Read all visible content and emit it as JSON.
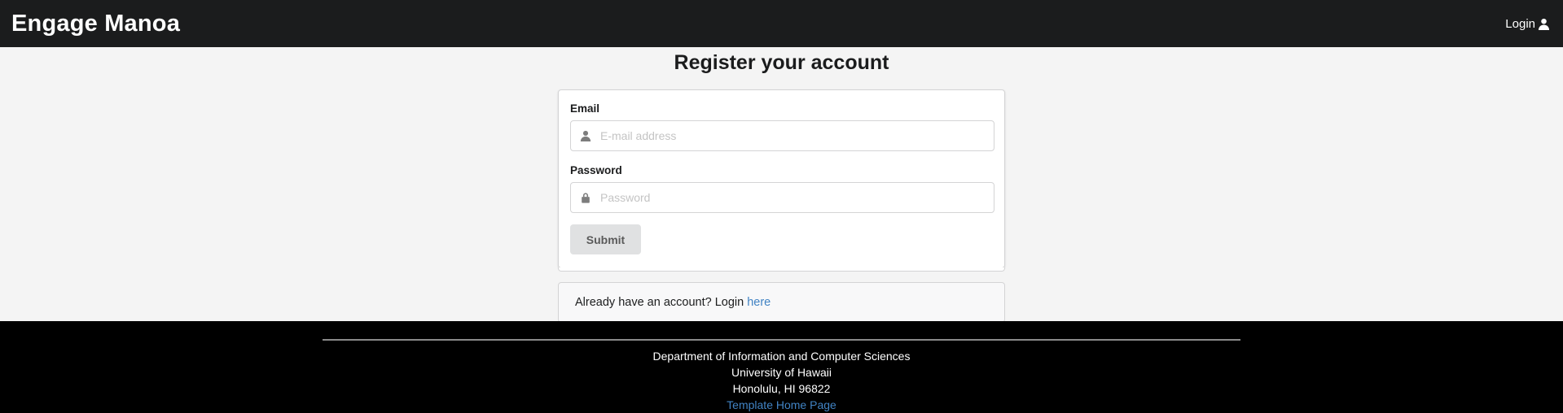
{
  "navbar": {
    "brand": "Engage Manoa",
    "login_label": "Login",
    "login_icon": "user-icon"
  },
  "page": {
    "title": "Register your account"
  },
  "form": {
    "email_label": "Email",
    "email_placeholder": "E-mail address",
    "email_value": "",
    "email_icon": "user-icon",
    "password_label": "Password",
    "password_placeholder": "Password",
    "password_value": "",
    "password_icon": "lock-icon",
    "submit_label": "Submit"
  },
  "message": {
    "text": "Already have an account? Login",
    "link_text": "here"
  },
  "footer": {
    "line1": "Department of Information and Computer Sciences",
    "line2": "University of Hawaii",
    "line3": "Honolulu, HI 96822",
    "link_text": "Template Home Page"
  },
  "colors": {
    "navbar_bg": "#1b1c1d",
    "page_bg": "#f4f4f4",
    "footer_bg": "#000000",
    "link": "#4183c4",
    "button_bg": "#e0e1e2"
  }
}
